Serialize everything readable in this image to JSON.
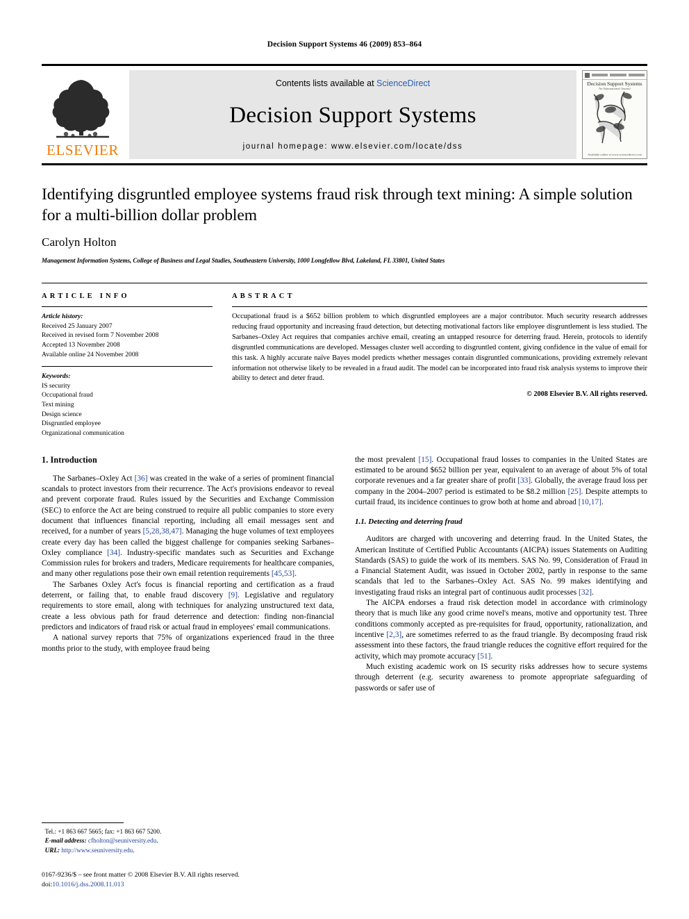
{
  "running_head": "Decision Support Systems 46 (2009) 853–864",
  "masthead": {
    "contents_prefix": "Contents lists available at ",
    "sciencedirect": "ScienceDirect",
    "journal_title": "Decision Support Systems",
    "homepage": "journal homepage: www.elsevier.com/locate/dss",
    "publisher_name": "ELSEVIER",
    "cover_title": "Decision Support Systems",
    "cover_subtitle": "An International Journal",
    "cover_footer": "Available online at www.sciencedirect.com",
    "accent_orange": "#F07C00",
    "link_blue": "#2a5db0"
  },
  "article": {
    "title": "Identifying disgruntled employee systems fraud risk through text mining: A simple solution for a multi-billion dollar problem",
    "author": "Carolyn Holton",
    "affiliation": "Management Information Systems, College of Business and Legal Studies, Southeastern University, 1000 Longfellow Blvd, Lakeland, FL 33801, United States"
  },
  "article_info": {
    "heading": "ARTICLE INFO",
    "history_label": "Article history:",
    "history": [
      "Received 25 January 2007",
      "Received in revised form 7 November 2008",
      "Accepted 13 November 2008",
      "Available online 24 November 2008"
    ],
    "keywords_label": "Keywords:",
    "keywords": [
      "IS security",
      "Occupational fraud",
      "Text mining",
      "Design science",
      "Disgruntled employee",
      "Organizational communication"
    ]
  },
  "abstract": {
    "heading": "ABSTRACT",
    "text": "Occupational fraud is a $652 billion problem to which disgruntled employees are a major contributor. Much security research addresses reducing fraud opportunity and increasing fraud detection, but detecting motivational factors like employee disgruntlement is less studied. The Sarbanes–Oxley Act requires that companies archive email, creating an untapped resource for deterring fraud. Herein, protocols to identify disgruntled communications are developed. Messages cluster well according to disgruntled content, giving confidence in the value of email for this task. A highly accurate naïve Bayes model predicts whether messages contain disgruntled communications, providing extremely relevant information not otherwise likely to be revealed in a fraud audit. The model can be incorporated into fraud risk analysis systems to improve their ability to detect and deter fraud.",
    "copyright": "© 2008 Elsevier B.V. All rights reserved."
  },
  "body": {
    "section1_heading": "1. Introduction",
    "left_paragraphs": [
      {
        "parts": [
          {
            "t": "The Sarbanes–Oxley Act "
          },
          {
            "t": "[36]",
            "cite": true
          },
          {
            "t": " was created in the wake of a series of prominent financial scandals to protect investors from their recurrence. The Act's provisions endeavor to reveal and prevent corporate fraud. Rules issued by the Securities and Exchange Commission (SEC) to enforce the Act are being construed to require all public companies to store every document that influences financial reporting, including all email messages sent and received, for a number of years "
          },
          {
            "t": "[5,28,38,47]",
            "cite": true
          },
          {
            "t": ". Managing the huge volumes of text employees create every day has been called the biggest challenge for companies seeking Sarbanes–Oxley compliance "
          },
          {
            "t": "[34]",
            "cite": true
          },
          {
            "t": ". Industry-specific mandates such as Securities and Exchange Commission rules for brokers and traders, Medicare requirements for healthcare companies, and many other regulations pose their own email retention requirements "
          },
          {
            "t": "[45,53]",
            "cite": true
          },
          {
            "t": "."
          }
        ]
      },
      {
        "parts": [
          {
            "t": "The Sarbanes Oxley Act's focus is financial reporting and certification as a fraud deterrent, or failing that, to enable fraud discovery "
          },
          {
            "t": "[9]",
            "cite": true
          },
          {
            "t": ". Legislative and regulatory requirements to store email, along with techniques for analyzing unstructured text data, create a less obvious path for fraud deterrence and detection: finding non-financial predictors and indicators of fraud risk or actual fraud in employees' email communications."
          }
        ]
      },
      {
        "parts": [
          {
            "t": "A national survey reports that 75% of organizations experienced fraud in the three months prior to the study, with employee fraud being"
          }
        ]
      }
    ],
    "right_paragraphs_top": [
      {
        "parts": [
          {
            "t": "the most prevalent "
          },
          {
            "t": "[15]",
            "cite": true
          },
          {
            "t": ". Occupational fraud losses to companies in the United States are estimated to be around $652 billion per year, equivalent to an average of about 5% of total corporate revenues and a far greater share of profit "
          },
          {
            "t": "[33]",
            "cite": true
          },
          {
            "t": ". Globally, the average fraud loss per company in the 2004–2007 period is estimated to be $8.2 million "
          },
          {
            "t": "[25]",
            "cite": true
          },
          {
            "t": ". Despite attempts to curtail fraud, its incidence continues to grow both at home and abroad "
          },
          {
            "t": "[10,17]",
            "cite": true
          },
          {
            "t": "."
          }
        ]
      }
    ],
    "section11_heading": "1.1. Detecting and deterring fraud",
    "right_paragraphs_bottom": [
      {
        "parts": [
          {
            "t": "Auditors are charged with uncovering and deterring fraud. In the United States, the American Institute of Certified Public Accountants (AICPA) issues Statements on Auditing Standards (SAS) to guide the work of its members. SAS No. 99, Consideration of Fraud in a Financial Statement Audit, was issued in October 2002, partly in response to the same scandals that led to the Sarbanes–Oxley Act. SAS No. 99 makes identifying and investigating fraud risks an integral part of continuous audit processes "
          },
          {
            "t": "[32]",
            "cite": true
          },
          {
            "t": "."
          }
        ]
      },
      {
        "parts": [
          {
            "t": "The AICPA endorses a fraud risk detection model in accordance with criminology theory that is much like any good crime novel's means, motive and opportunity test. Three conditions commonly accepted as pre-requisites for fraud, opportunity, rationalization, and incentive "
          },
          {
            "t": "[2,3]",
            "cite": true
          },
          {
            "t": ", are sometimes referred to as the fraud triangle. By decomposing fraud risk assessment into these factors, the fraud triangle reduces the cognitive effort required for the activity, which may promote accuracy "
          },
          {
            "t": "[51]",
            "cite": true
          },
          {
            "t": "."
          }
        ]
      },
      {
        "parts": [
          {
            "t": "Much existing academic work on IS security risks addresses how to secure systems through deterrent (e.g. security awareness to promote appropriate safeguarding of passwords or safer use of"
          }
        ]
      }
    ]
  },
  "footnote": {
    "tel": "Tel.: +1 863 667 5665; fax: +1 863 667 5200.",
    "email_label": "E-mail address:",
    "email": "cfholton@seuniversity.edu",
    "url_label": "URL:",
    "url": "http://www.seuniversity.edu",
    "email_suffix": ".",
    "url_suffix": "."
  },
  "imprint": {
    "line1": "0167-9236/$ – see front matter © 2008 Elsevier B.V. All rights reserved.",
    "doi_label": "doi:",
    "doi": "10.1016/j.dss.2008.11.013"
  }
}
